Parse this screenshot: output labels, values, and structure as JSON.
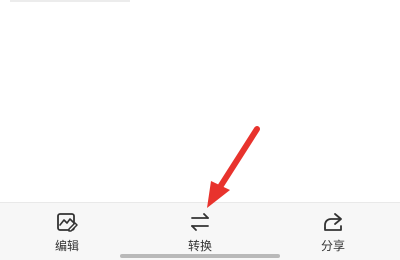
{
  "toolbar": {
    "items": [
      {
        "label": "编辑",
        "icon": "image-edit-icon"
      },
      {
        "label": "转换",
        "icon": "swap-arrows-icon"
      },
      {
        "label": "分享",
        "icon": "share-icon"
      }
    ]
  },
  "annotation": {
    "color": "#e8332d",
    "icon": "arrow-annotation"
  },
  "colors": {
    "toolbar_bg": "#f7f7f7",
    "icon": "#333333",
    "home_indicator": "#b9b9b9"
  }
}
